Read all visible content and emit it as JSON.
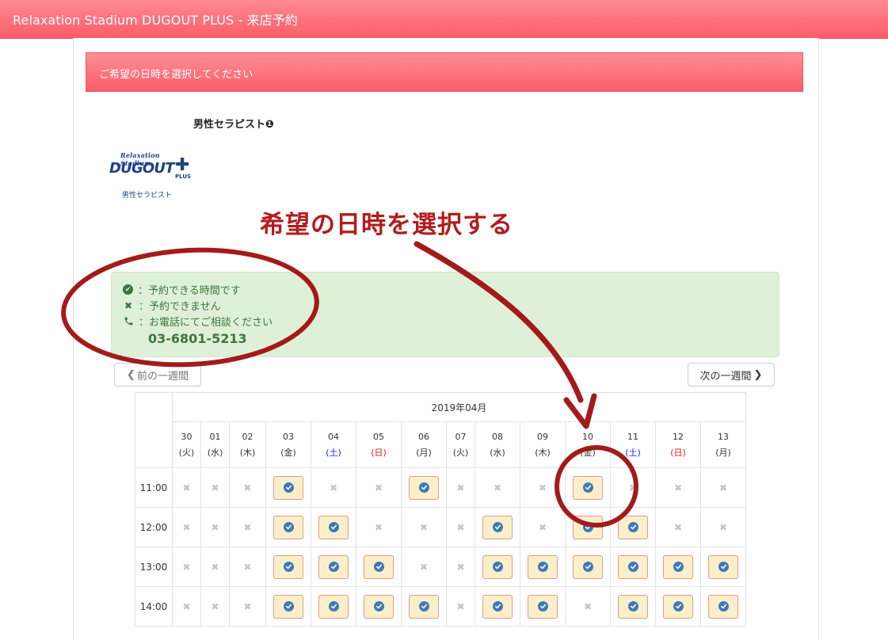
{
  "header": {
    "title": "Relaxation Stadium DUGOUT PLUS - 来店予約"
  },
  "instruction": {
    "text": "ご希望の日時を選択してください"
  },
  "therapist": {
    "name": "男性セラピスト❶"
  },
  "logo": {
    "line1": "Relaxation Stadium",
    "line2": "DUGOUT",
    "plus_text": "PLUS",
    "subtitle": "男性セラピスト"
  },
  "annotation": {
    "text": "希望の日時を選択する",
    "color": "#b41c1c"
  },
  "legend": {
    "available": "：予約できる時間です",
    "unavailable": "：予約できません",
    "phone": "：お電話にてご相談ください",
    "phone_number": "03-6801-5213"
  },
  "nav": {
    "prev_label": "前の一週間",
    "next_label": "次の一週間"
  },
  "calendar": {
    "month_label": "2019年04月",
    "days": [
      {
        "date": "30",
        "dow": "(火)",
        "type": "weekday"
      },
      {
        "date": "01",
        "dow": "(水)",
        "type": "weekday"
      },
      {
        "date": "02",
        "dow": "(木)",
        "type": "weekday"
      },
      {
        "date": "03",
        "dow": "(金)",
        "type": "weekday"
      },
      {
        "date": "04",
        "dow": "(土)",
        "type": "sat"
      },
      {
        "date": "05",
        "dow": "(日)",
        "type": "sun"
      },
      {
        "date": "06",
        "dow": "(月)",
        "type": "weekday"
      },
      {
        "date": "07",
        "dow": "(火)",
        "type": "weekday"
      },
      {
        "date": "08",
        "dow": "(水)",
        "type": "weekday"
      },
      {
        "date": "09",
        "dow": "(木)",
        "type": "weekday"
      },
      {
        "date": "10",
        "dow": "(金)",
        "type": "weekday"
      },
      {
        "date": "11",
        "dow": "(土)",
        "type": "sat"
      },
      {
        "date": "12",
        "dow": "(日)",
        "type": "sun"
      },
      {
        "date": "13",
        "dow": "(月)",
        "type": "weekday"
      }
    ],
    "slots": [
      {
        "time": "11:00",
        "avail": [
          0,
          0,
          0,
          1,
          0,
          0,
          1,
          0,
          0,
          0,
          1,
          0,
          0,
          0
        ]
      },
      {
        "time": "12:00",
        "avail": [
          0,
          0,
          0,
          1,
          1,
          0,
          0,
          0,
          1,
          0,
          1,
          1,
          0,
          0
        ]
      },
      {
        "time": "13:00",
        "avail": [
          0,
          0,
          0,
          1,
          1,
          1,
          0,
          0,
          1,
          1,
          1,
          1,
          1,
          1
        ]
      },
      {
        "time": "14:00",
        "avail": [
          0,
          0,
          0,
          1,
          1,
          1,
          1,
          0,
          1,
          1,
          0,
          1,
          1,
          1
        ]
      }
    ]
  },
  "colors": {
    "header": "#fb5c68",
    "legend_bg": "#dff0d8",
    "legend_text": "#3c763d",
    "slot_bg": "#fbefc9",
    "check_icon": "#3d78c0",
    "saturday": "#1a1aff",
    "sunday": "#e02020"
  }
}
